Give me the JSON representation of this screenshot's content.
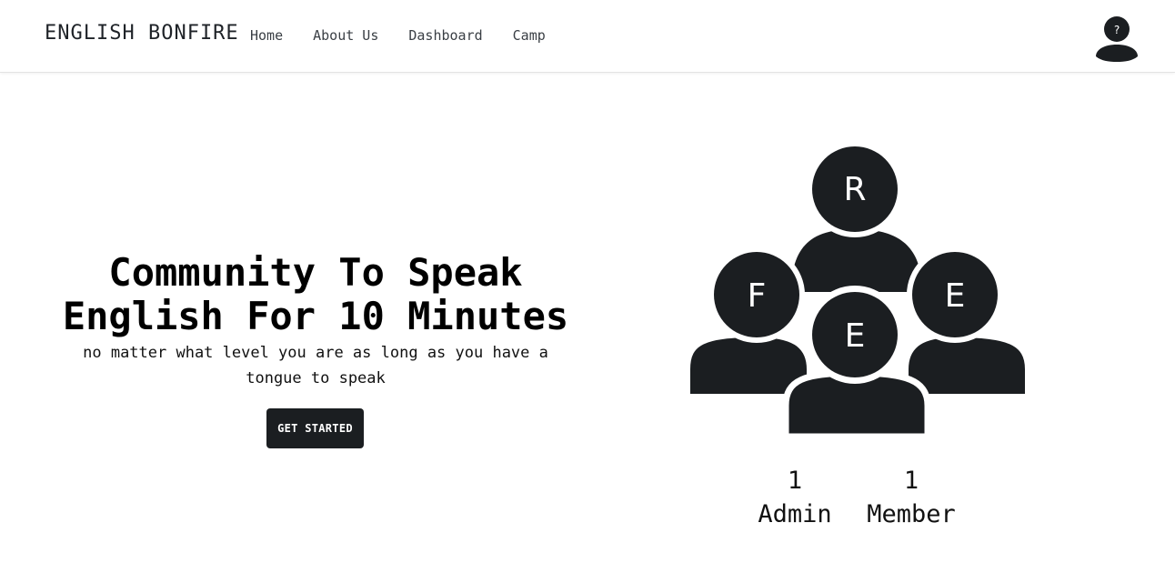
{
  "nav": {
    "brand": "ENGLISH BONFIRE",
    "links": [
      "Home",
      "About Us",
      "Dashboard",
      "Camp"
    ],
    "avatar_badge": "?",
    "avatar_icon": "user-icon"
  },
  "hero": {
    "title_line1": "Community To Speak",
    "title_line2": "English For 10 Minutes",
    "subtitle": "no matter what level you are as long as you have a tongue to speak",
    "cta_label": "GET STARTED"
  },
  "illustration": {
    "icon": "group-users-icon",
    "initials": {
      "top": "R",
      "left": "F",
      "right": "E",
      "center": "E"
    }
  },
  "stats": {
    "admin_count": "1",
    "admin_label": "Admin",
    "member_count": "1",
    "member_label": "Member"
  },
  "colors": {
    "dark": "#1b1e21",
    "text": "#000000",
    "background": "#ffffff"
  }
}
